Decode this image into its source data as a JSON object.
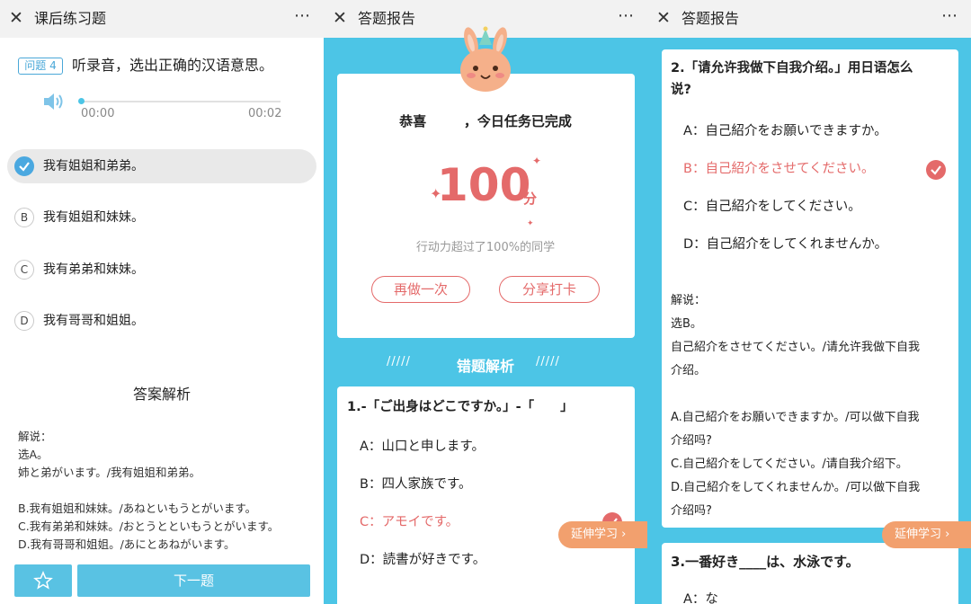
{
  "panel1": {
    "title": "课后练习题",
    "close": "✕",
    "more": "⋯",
    "question_badge": "问题 4",
    "question_text": "听录音，选出正确的汉语意思。",
    "audio": {
      "current_time": "00:00",
      "total_time": "00:02",
      "progress": 0.0
    },
    "options": [
      {
        "letter": "A",
        "text": "我有姐姐和弟弟。",
        "selected": true
      },
      {
        "letter": "B",
        "text": "我有姐姐和妹妹。",
        "selected": false
      },
      {
        "letter": "C",
        "text": "我有弟弟和妹妹。",
        "selected": false
      },
      {
        "letter": "D",
        "text": "我有哥哥和姐姐。",
        "selected": false
      }
    ],
    "answer_title": "答案解析",
    "explanation": [
      "解说：",
      "选A。",
      "姉と弟がいます。/我有姐姐和弟弟。",
      "",
      "B.我有姐姐和妹妹。/あねといもうとがいます。",
      "C.我有弟弟和妹妹。/おとうとといもうとがいます。",
      "D.我有哥哥和姐姐。/あにとあねがいます。"
    ],
    "next_label": "下一题",
    "accent": "#59c2e3"
  },
  "panel2": {
    "title": "答题报告",
    "close": "✕",
    "more": "⋯",
    "congrats": "恭喜        ，今日任务已完成",
    "score": "100",
    "score_unit": "分",
    "stat": "行动力超过了100%的同学",
    "redo_label": "再做一次",
    "share_label": "分享打卡",
    "section_title": "错题解析",
    "slashes": "/////",
    "q1": {
      "title": "1.-「ご出身はどこですか。」-「　　」",
      "options": [
        "A：山口と申します。",
        "B：四人家族です。",
        "C：アモイです。",
        "D：読書が好きです。"
      ]
    },
    "extend_label": "延伸学习 ›",
    "accent_red": "#e46a6a"
  },
  "panel3": {
    "title": "答题报告",
    "close": "✕",
    "more": "⋯",
    "q2": {
      "title_line1": "2.「请允许我做下自我介绍。」用日语怎么",
      "title_line2": "说?",
      "options": [
        "A：自己紹介をお願いできますか。",
        "B：自己紹介をさせてください。",
        "C：自己紹介をしてください。",
        "D：自己紹介をしてくれませんか。"
      ]
    },
    "explanation": [
      "解说：",
      "选B。",
      "自己紹介をさせてください。/请允许我做下自我",
      "介绍。",
      "",
      "A.自己紹介をお願いできますか。/可以做下自我",
      "介绍吗?",
      "C.自己紹介をしてください。/请自我介绍下。",
      "D.自己紹介をしてくれませんか。/可以做下自我",
      "介绍吗?"
    ],
    "extend_label": "延伸学习 ›",
    "q3": {
      "title": "3.一番好き____は、水泳です。",
      "first_option": "A：な"
    }
  }
}
